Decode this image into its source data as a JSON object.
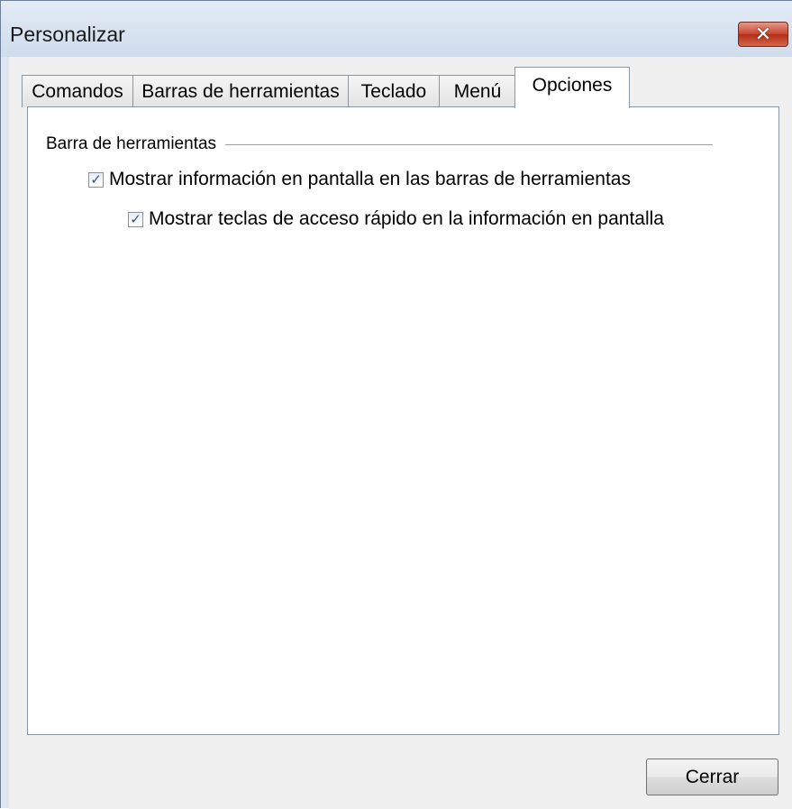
{
  "window": {
    "title": "Personalizar",
    "close_symbol": "✕"
  },
  "tabs": [
    {
      "label": "Comandos",
      "active": false
    },
    {
      "label": "Barras de herramientas",
      "active": false
    },
    {
      "label": "Teclado",
      "active": false
    },
    {
      "label": "Menú",
      "active": false
    },
    {
      "label": "Opciones",
      "active": true
    }
  ],
  "options": {
    "group_title": "Barra de herramientas",
    "show_tooltips": {
      "label": "Mostrar información en pantalla en las barras de herramientas",
      "checked": true
    },
    "show_shortcut_keys": {
      "label": "Mostrar teclas de acceso rápido en la información en pantalla",
      "checked": true
    },
    "check_glyph": "✓"
  },
  "buttons": {
    "close_label": "Cerrar"
  },
  "icons": {
    "close": "close-icon",
    "checkmark": "checkmark-icon"
  }
}
